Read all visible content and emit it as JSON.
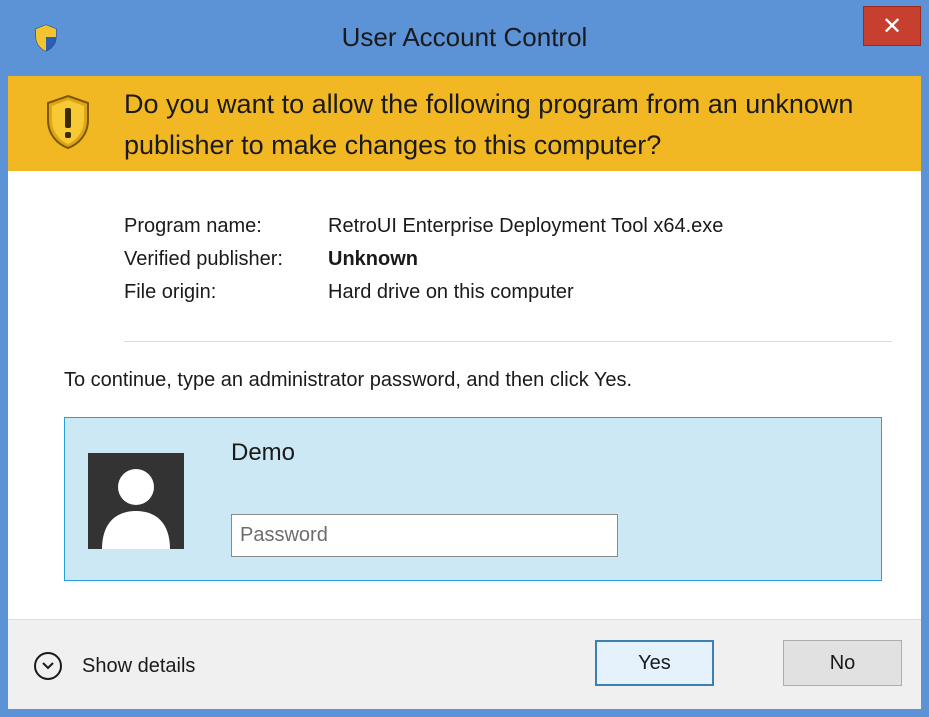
{
  "window": {
    "title": "User Account Control",
    "close_glyph": "✕"
  },
  "banner": {
    "message": "Do you want to allow the following program from an unknown publisher to make changes to this computer?"
  },
  "details": {
    "rows": [
      {
        "label": "Program name:",
        "value": "RetroUI Enterprise Deployment Tool x64.exe"
      },
      {
        "label": "Verified publisher:",
        "value": "Unknown"
      },
      {
        "label": "File origin:",
        "value": "Hard drive on this computer"
      }
    ]
  },
  "instruction": "To continue, type an administrator password, and then click Yes.",
  "credential": {
    "username": "Demo",
    "password_placeholder": "Password",
    "password_value": ""
  },
  "footer": {
    "show_details_label": "Show details",
    "yes_label": "Yes",
    "no_label": "No"
  },
  "colors": {
    "titlebar": "#5c92d6",
    "banner": "#f2b823",
    "tile": "#cde8f5",
    "close": "#c7402f"
  },
  "icons": [
    "uac-shield-icon",
    "warning-shield-icon",
    "close-icon",
    "user-avatar-icon",
    "chevron-down-icon"
  ]
}
